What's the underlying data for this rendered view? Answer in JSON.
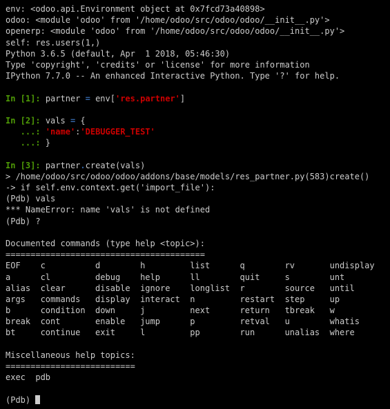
{
  "header": [
    "env: <odoo.api.Environment object at 0x7fcd73a40898>",
    "odoo: <module 'odoo' from '/home/odoo/src/odoo/odoo/__init__.py'>",
    "openerp: <module 'odoo' from '/home/odoo/src/odoo/odoo/__init__.py'>",
    "self: res.users(1,)",
    "Python 3.6.5 (default, Apr  1 2018, 05:46:30)",
    "Type 'copyright', 'credits' or 'license' for more information",
    "IPython 7.7.0 -- An enhanced Interactive Python. Type '?' for help.",
    ""
  ],
  "prompts": {
    "in": "In [",
    "close": "]: ",
    "cont_in": "   ...: ",
    "n1": "1",
    "n2": "2",
    "n3": "3"
  },
  "cells": {
    "c1": {
      "pre": "partner ",
      "op": "=",
      "mid": " env[",
      "str": "'res.partner'",
      "end": "]"
    },
    "c2": {
      "line1_pre": "vals ",
      "line1_op": "=",
      "line1_end": " {",
      "line2_key": "'name'",
      "line2_sep": ":",
      "line2_val": "'DEBUGGER_TEST'",
      "line3": "}"
    },
    "c3": {
      "pre": "partner",
      "op": ".",
      "call": "create(vals)"
    }
  },
  "pdb": {
    "trace": "> /home/odoo/src/odoo/odoo/addons/base/models/res_partner.py(583)create()",
    "arrow": "-> if self.env.context.get('import_file'):",
    "p1": "(Pdb) vals",
    "err": "*** NameError: name 'vals' is not defined",
    "p2": "(Pdb) ?",
    "p3": "(Pdb) "
  },
  "help": {
    "title": "Documented commands (type help <topic>):",
    "rule1": "========================================",
    "rows": [
      "EOF    c          d        h         list      q        rv       undisplay",
      "a      cl         debug    help      ll        quit     s        unt",
      "alias  clear      disable  ignore    longlist  r        source   until",
      "args   commands   display  interact  n         restart  step     up",
      "b      condition  down     j         next      return   tbreak   w",
      "break  cont       enable   jump      p         retval   u        whatis",
      "bt     continue   exit     l         pp        run      unalias  where"
    ],
    "misc_title": "Miscellaneous help topics:",
    "rule2": "==========================",
    "misc": "exec  pdb"
  }
}
